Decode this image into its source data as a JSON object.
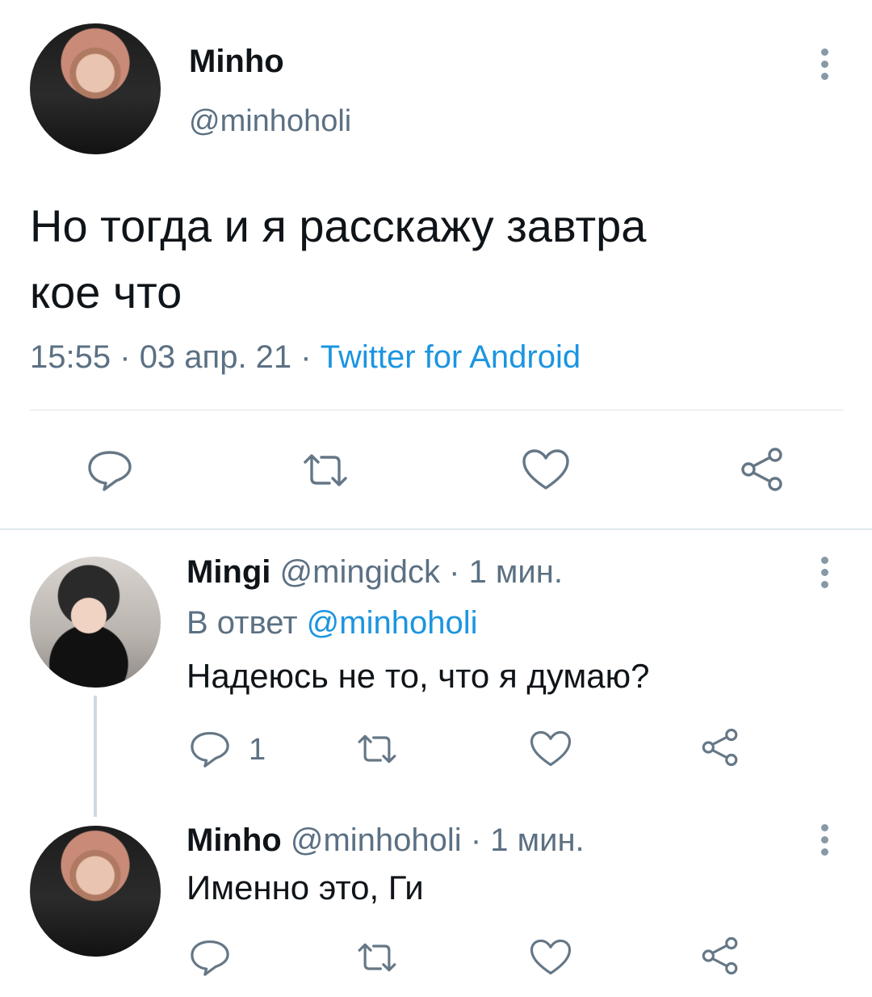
{
  "main_tweet": {
    "author_name": "Minho",
    "author_handle": "@minhoholi",
    "text_line1": "Но тогда и я расскажу завтра",
    "text_line2": "кое что",
    "time": "15:55",
    "sep1": "·",
    "date": "03 апр. 21",
    "sep2": "·",
    "source": "Twitter for Android"
  },
  "reply1": {
    "author_name": "Mingi",
    "author_handle": "@mingidck",
    "sep": "·",
    "time_ago": "1 мин.",
    "reply_to_prefix": "В ответ",
    "reply_to_handle": "@minhoholi",
    "text": "Надеюсь не то, что я думаю?",
    "reply_count": "1"
  },
  "reply2": {
    "author_name": "Minho",
    "author_handle": "@minhoholi",
    "sep": "·",
    "time_ago": "1 мин.",
    "text": "Именно это, Ги"
  },
  "icons": {
    "reply": "speech-bubble-icon",
    "retweet": "retweet-arrows-icon",
    "like": "heart-icon",
    "share": "share-nodes-icon",
    "more": "vertical-ellipsis-icon"
  },
  "colors": {
    "text": "#0f1419",
    "secondary": "#5b7083",
    "link": "#1b95e0",
    "divider": "#e1e8ed"
  }
}
